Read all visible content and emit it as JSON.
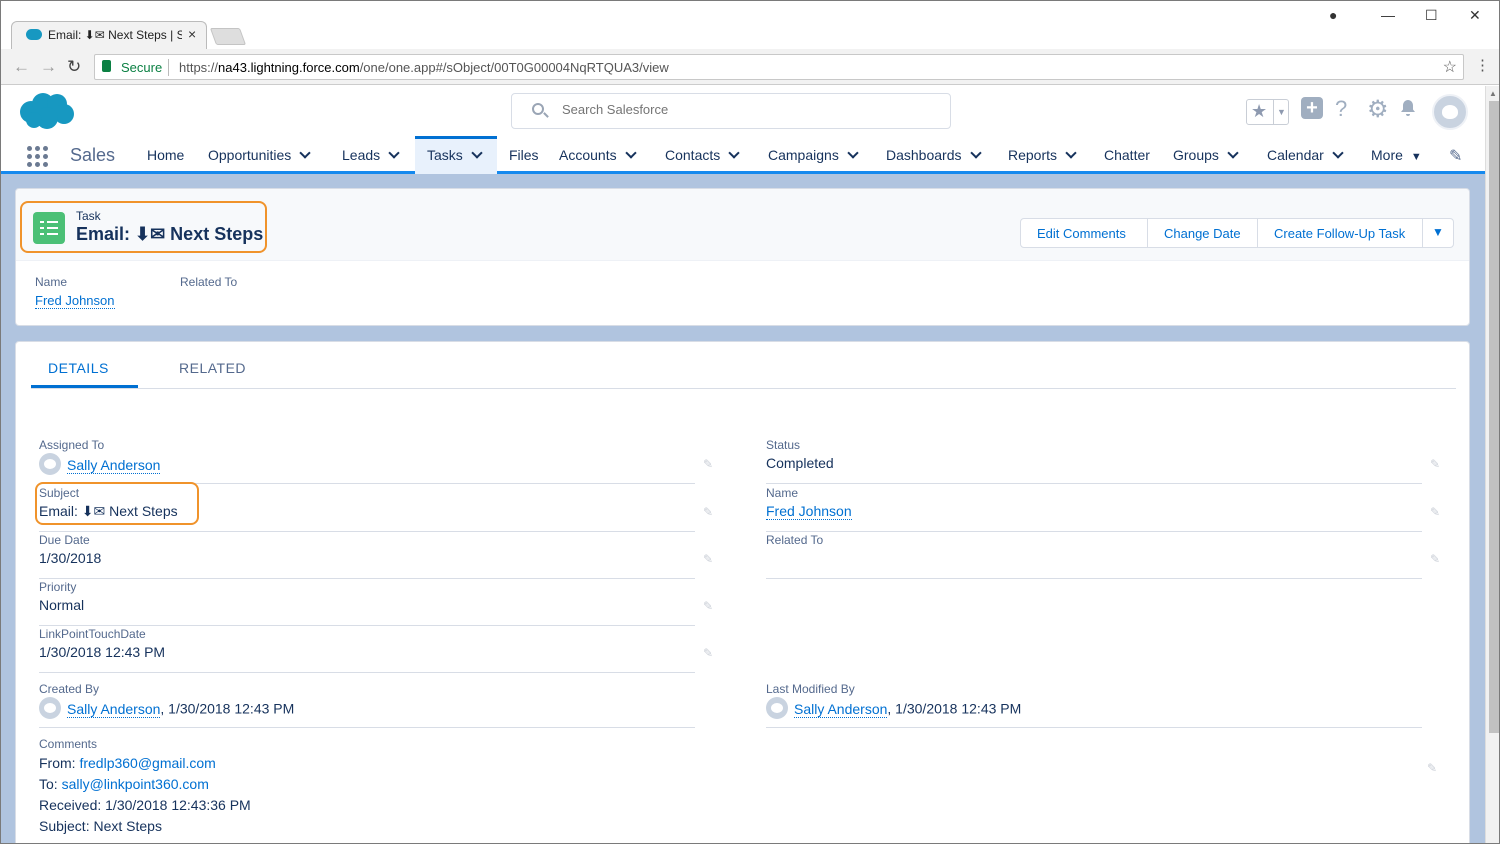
{
  "browser": {
    "tab_title": "Email: ⬇✉ Next Steps | Sa",
    "tab_close": "×",
    "secure_label": "Secure",
    "url_scheme": "https://",
    "url_host": "na43.lightning.force.com",
    "url_path": "/one/one.app#/sObject/00T0G00004NqRTQUA3/view",
    "window_controls": [
      "—",
      "☐",
      "✕"
    ]
  },
  "header": {
    "search_placeholder": "Search Salesforce",
    "app_name": "Sales",
    "nav_items": [
      {
        "label": "Home",
        "dropdown": false
      },
      {
        "label": "Opportunities",
        "dropdown": true
      },
      {
        "label": "Leads",
        "dropdown": true
      },
      {
        "label": "Tasks",
        "dropdown": true,
        "active": true
      },
      {
        "label": "Files",
        "dropdown": false
      },
      {
        "label": "Accounts",
        "dropdown": true
      },
      {
        "label": "Contacts",
        "dropdown": true
      },
      {
        "label": "Campaigns",
        "dropdown": true
      },
      {
        "label": "Dashboards",
        "dropdown": true
      },
      {
        "label": "Reports",
        "dropdown": true
      },
      {
        "label": "Chatter",
        "dropdown": false
      },
      {
        "label": "Groups",
        "dropdown": true
      },
      {
        "label": "Calendar",
        "dropdown": true
      },
      {
        "label": "More",
        "dropdown": true
      }
    ]
  },
  "record": {
    "type": "Task",
    "title": "Email: ⬇✉ Next Steps",
    "actions": [
      "Edit Comments",
      "Change Date",
      "Create Follow-Up Task"
    ],
    "highlights": {
      "name_label": "Name",
      "name_value": "Fred Johnson",
      "related_label": "Related To"
    }
  },
  "tabs": {
    "details": "DETAILS",
    "related": "RELATED"
  },
  "fields": {
    "assigned_to": {
      "label": "Assigned To",
      "value": "Sally Anderson"
    },
    "subject": {
      "label": "Subject",
      "value": "Email: ⬇✉ Next Steps"
    },
    "due_date": {
      "label": "Due Date",
      "value": "1/30/2018"
    },
    "priority": {
      "label": "Priority",
      "value": "Normal"
    },
    "lp_touch": {
      "label": "LinkPointTouchDate",
      "value": "1/30/2018 12:43 PM"
    },
    "status": {
      "label": "Status",
      "value": "Completed"
    },
    "name": {
      "label": "Name",
      "value": "Fred Johnson"
    },
    "related_to": {
      "label": "Related To",
      "value": ""
    },
    "created_by": {
      "label": "Created By",
      "user": "Sally Anderson",
      "date": ", 1/30/2018 12:43 PM"
    },
    "modified_by": {
      "label": "Last Modified By",
      "user": "Sally Anderson",
      "date": ", 1/30/2018 12:43 PM"
    }
  },
  "comments": {
    "label": "Comments",
    "from_label": "From: ",
    "from_email": "fredlp360@gmail.com",
    "to_label": "To: ",
    "to_email": "sally@linkpoint360.com",
    "received": "Received: 1/30/2018 12:43:36 PM",
    "subject": "Subject: Next Steps"
  },
  "colors": {
    "brand": "#0070d2",
    "highlight": "#f0932b",
    "task_icon": "#4bc076"
  }
}
